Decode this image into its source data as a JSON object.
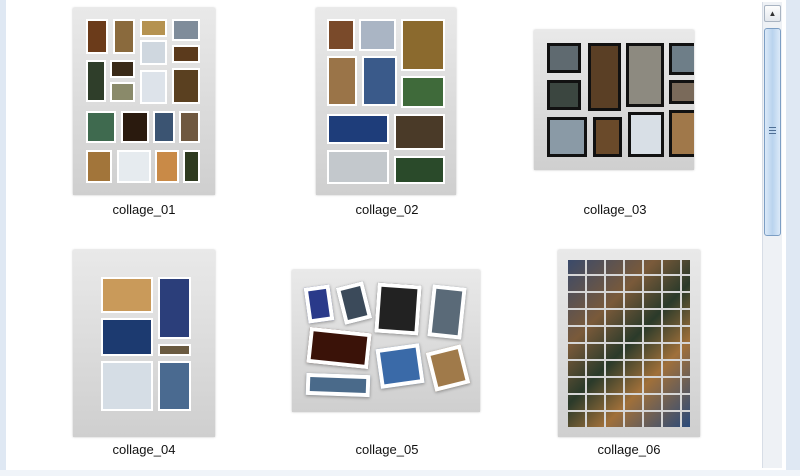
{
  "files": [
    {
      "name": "collage_01"
    },
    {
      "name": "collage_02"
    },
    {
      "name": "collage_03"
    },
    {
      "name": "collage_04"
    },
    {
      "name": "collage_05"
    },
    {
      "name": "collage_06"
    }
  ],
  "scrollbar": {
    "up_arrow": "▲"
  },
  "colors": {
    "thumb_bg": "#dcdcdc",
    "scroll_thumb": "#b9d3ee",
    "selection_frame": "#dfe8f3"
  }
}
